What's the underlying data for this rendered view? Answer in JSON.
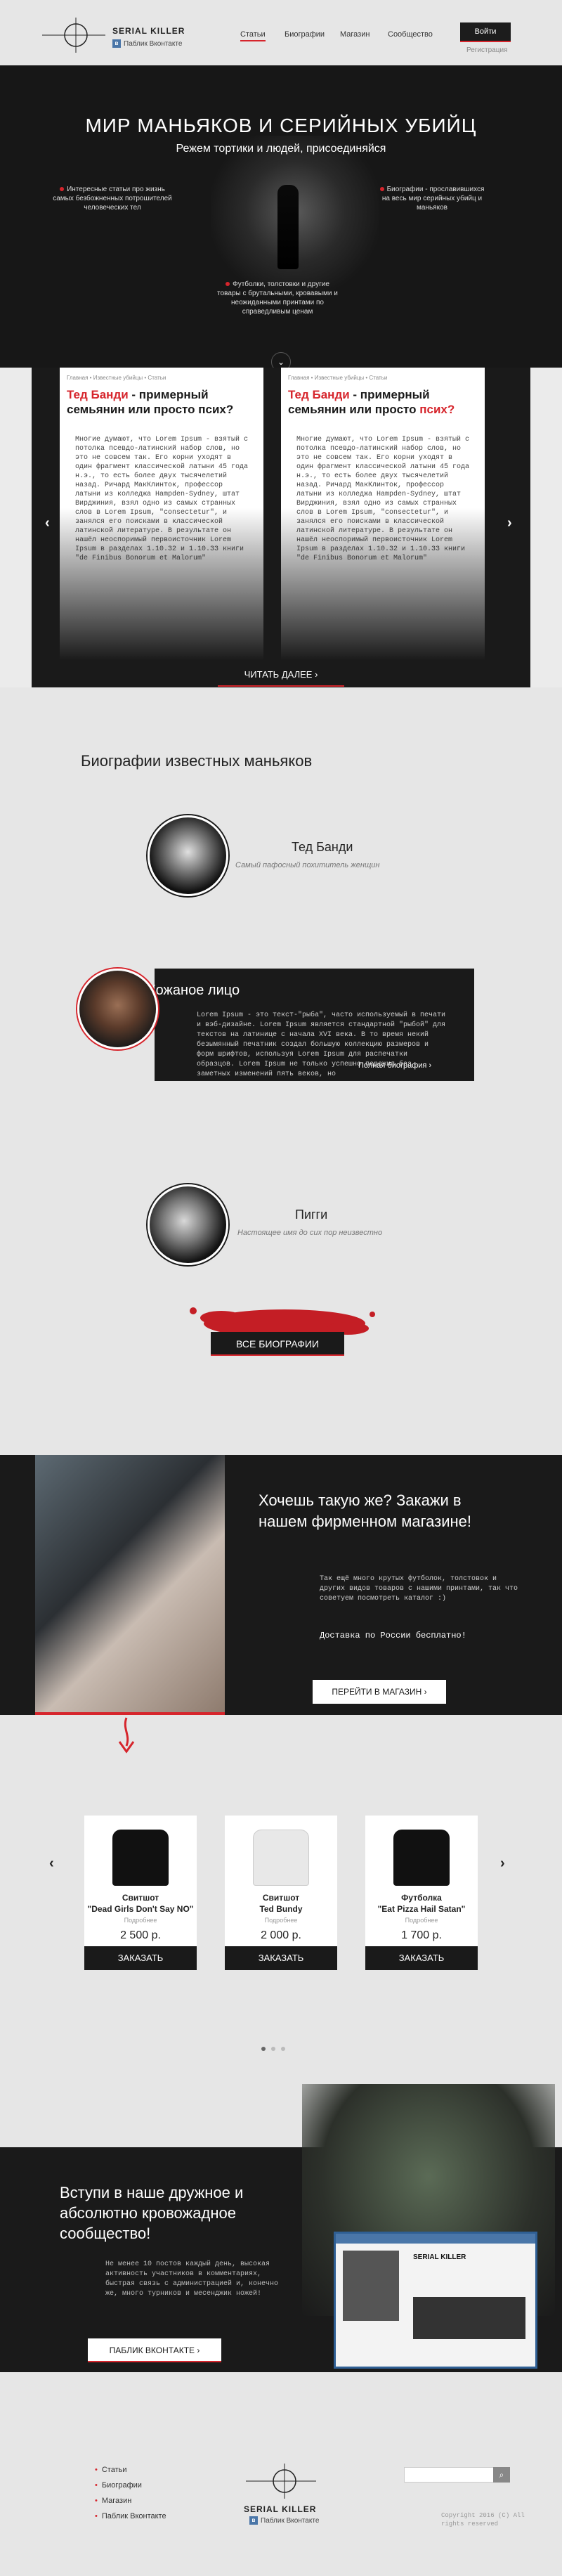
{
  "header": {
    "logo_text": "SERIAL KILLER",
    "vk_label": "Паблик Вконтакте",
    "nav": [
      "Статьи",
      "Биографии",
      "Магазин",
      "Сообщество"
    ],
    "login": "Войти",
    "register": "Регистрация"
  },
  "hero": {
    "title": "МИР МАНЬЯКОВ И СЕРИЙНЫХ УБИЙЦ",
    "subtitle": "Режем тортики и людей, присоединяйся",
    "note_left": "Интересные статьи про жизнь самых безбожненных потрошителей человеческих тел",
    "note_right": "Биографии - прославившихся на весь мир серийных убийц и маньяков",
    "note_bottom": "Футболки, толстовки и другие товары с брутальными, кровавыми и неожиданными принтами по справедливым ценам"
  },
  "articles": {
    "cards": [
      {
        "crumb": "Главная • Известные убийцы • Статьи",
        "title_a": "Тед Банди",
        "title_b": " - примерный семьянин или просто псих?",
        "body": "Многие думают, что Lorem Ipsum - взятый с потолка псевдо-латинский набор слов, но это не совсем так. Его корни уходят в один фрагмент классической латыни 45 года н.э., то есть более двух тысячелетий назад. Ричард МакКлинток, профессор латыни из колледжа Hampden-Sydney, штат Вирджиния, взял одно из самых странных слов в Lorem Ipsum, \"consectetur\", и занялся его поисками в классической латинской литературе. В результате он нашёл неоспоримый первоисточник Lorem Ipsum в разделах 1.10.32 и 1.10.33 книги \"de Finibus Bonorum et Malorum\""
      },
      {
        "crumb": "Главная • Известные убийцы • Статьи",
        "title_a": "Тед Банди",
        "title_b": " - примерный семьянин или просто ",
        "title_c": "псих?",
        "body": "Многие думают, что Lorem Ipsum - взятый с потолка псевдо-латинский набор слов, но это не совсем так. Его корни уходят в один фрагмент классической латыни 45 года н.э., то есть более двух тысячелетий назад. Ричард МакКлинток, профессор латыни из колледжа Hampden-Sydney, штат Вирджиния, взял одно из самых странных слов в Lorem Ipsum, \"consectetur\", и занялся его поисками в классической латинской литературе. В результате он нашёл неоспоримый первоисточник Lorem Ipsum в разделах 1.10.32 и 1.10.33 книги \"de Finibus Bonorum et Malorum\""
      }
    ],
    "read_more": "ЧИТАТЬ ДАЛЕЕ"
  },
  "bios": {
    "section_title": "Биографии известных маньяков",
    "items": [
      {
        "name": "Тед Банди",
        "sub": "Самый пафосный похититель женщин"
      },
      {
        "name": "Кожаное лицо",
        "text": "Lorem Ipsum - это текст-\"рыба\", часто используемый в печати и вэб-дизайне. Lorem Ipsum является стандартной \"рыбой\" для текстов на латинице с начала XVI века. В то время некий безымянный печатник создал большую коллекцию размеров и форм шрифтов, используя Lorem Ipsum для распечатки образцов. Lorem Ipsum не только успешно пережил без заметных изменений пять веков, но",
        "link": "Полная биография"
      },
      {
        "name": "Пигги",
        "sub": "Настоящее имя до сих пор неизвестно"
      }
    ],
    "all_button": "ВСЕ БИОГРАФИИ"
  },
  "shop_promo": {
    "title": "Хочешь такую же? Закажи в нашем фирменном магазине!",
    "text": "Так ещё много крутых футболок, толстовок и других видов товаров с нашими принтами, так что советуем посмотреть каталог :)",
    "shipping": "Доставка по России бесплатно!",
    "button": "ПЕРЕЙТИ В МАГАЗИН"
  },
  "products": [
    {
      "type": "Свитшот",
      "name": "\"Dead Girls Don't Say NO\"",
      "style": "Подробнее",
      "price": "2 500 р.",
      "button": "ЗАКАЗАТЬ",
      "color": "#111111"
    },
    {
      "type": "Свитшот",
      "name": "Ted Bundy",
      "style": "Подробнее",
      "price": "2 000 р.",
      "button": "ЗАКАЗАТЬ",
      "color": "#e8e8e8"
    },
    {
      "type": "Футболка",
      "name": "\"Eat Pizza Hail Satan\"",
      "style": "Подробнее",
      "price": "1 700 р.",
      "button": "ЗАКАЗАТЬ",
      "color": "#111111"
    }
  ],
  "community": {
    "title": "Вступи в наше дружное и абсолютно кровожадное сообщество!",
    "text": "Не менее 10 постов каждый день, высокая активность участников в комментариях, быстрая связь с администрацией и, конечно же, много турников и месенджик ножей!",
    "button": "ПАБЛИК ВКОНТАКТЕ",
    "screen_name": "SERIAL KILLER"
  },
  "footer": {
    "nav": [
      "Статьи",
      "Биографии",
      "Магазин",
      "Паблик Вконтакте"
    ],
    "logo_text": "SERIAL KILLER",
    "vk_label": "Паблик Вконтакте",
    "copyright": "Copyright 2016 (C) All rights reserved"
  },
  "colors": {
    "accent": "#d6252c",
    "dark": "#1a1a1a",
    "light": "#e6e6e6"
  }
}
